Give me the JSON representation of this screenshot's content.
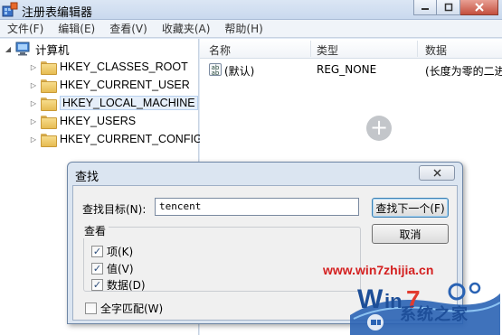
{
  "window": {
    "title": "注册表编辑器",
    "controls": [
      "minimize",
      "maximize",
      "close"
    ]
  },
  "menu": [
    "文件(F)",
    "编辑(E)",
    "查看(V)",
    "收藏夹(A)",
    "帮助(H)"
  ],
  "tree": {
    "root": "计算机",
    "items": [
      "HKEY_CLASSES_ROOT",
      "HKEY_CURRENT_USER",
      "HKEY_LOCAL_MACHINE",
      "HKEY_USERS",
      "HKEY_CURRENT_CONFIG"
    ],
    "selected": "HKEY_LOCAL_MACHINE"
  },
  "list": {
    "columns": [
      "名称",
      "类型",
      "数据"
    ],
    "rows": [
      {
        "icon": "ab-icon",
        "name": "(默认)",
        "type": "REG_NONE",
        "data": "(长度为零的二进"
      }
    ]
  },
  "find_dialog": {
    "title": "查找",
    "close_icon": "x",
    "find_label": "查找目标(N):",
    "find_value": "tencent",
    "find_next_button": "查找下一个(F)",
    "cancel_button": "取消",
    "look_at_group": "查看",
    "options": [
      {
        "label": "项(K)",
        "checked": true
      },
      {
        "label": "值(V)",
        "checked": true
      },
      {
        "label": "数据(D)",
        "checked": true
      }
    ],
    "match_whole": {
      "label": "全字匹配(W)",
      "checked": false
    }
  },
  "watermark": {
    "url": "www.win7zhijia.cn",
    "site": "系统之家"
  },
  "colors": {
    "watermark_red": "#d42020",
    "watermark_blue": "#1e4f9a",
    "selection": "#e5eef9"
  }
}
